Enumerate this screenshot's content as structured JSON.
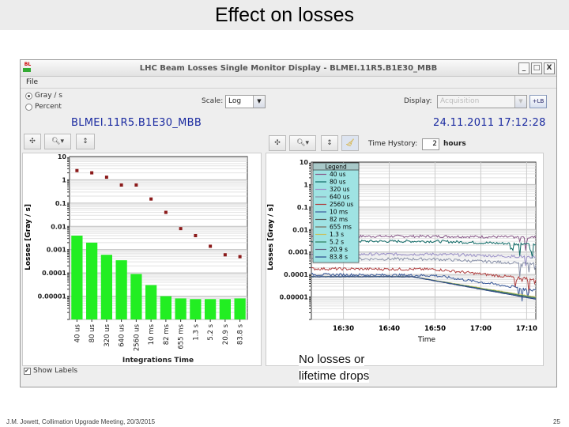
{
  "slide": {
    "title": "Effect on losses",
    "footer": "J.M. Jowett, Collimation Upgrade Meeting, 20/3/2015",
    "page": "25",
    "note_line1": "No losses or",
    "note_line2": "lifetime drops"
  },
  "window": {
    "title": "LHC Beam Losses Single Monitor Display - BLMEI.11R5.B1E30_MBB",
    "icon_text": "BL",
    "minimize": "_",
    "maximize": "□",
    "close": "X"
  },
  "menu": {
    "file": "File"
  },
  "controls": {
    "unit_gray": "Gray / s",
    "unit_percent": "Percent",
    "unit_selected": "Gray / s",
    "scale_label": "Scale:",
    "scale_value": "Log",
    "display_label": "Display:",
    "display_value": "Acquisition",
    "display_button": "+LB",
    "monitor": "BLMEI.11R5.B1E30_MBB",
    "timestamp": "24.11.2011 17:12:28",
    "time_history_label": "Time Hystory:",
    "time_history_value": "2",
    "time_history_unit": "hours",
    "show_labels": "Show Labels",
    "show_labels_checked": true
  },
  "chart_data": [
    {
      "type": "bar",
      "ylabel": "Losses [Gray / s]",
      "xlabel": "Integrations Time",
      "yscale": "log",
      "ylim": [
        1e-06,
        10
      ],
      "yticks": [
        "10",
        "1",
        "0.1",
        "0.01",
        "0.001",
        "0.0001",
        "0.00001"
      ],
      "categories": [
        "40 us",
        "80 us",
        "320 us",
        "640 us",
        "2560 us",
        "10 ms",
        "82 ms",
        "655 ms",
        "1.3 s",
        "5.2 s",
        "20.9 s",
        "83.8 s"
      ],
      "series": [
        {
          "kind": "bar",
          "color": "#22ee22",
          "values": [
            0.004,
            0.002,
            0.0006,
            0.00035,
            9e-05,
            3e-05,
            1e-05,
            8e-06,
            7.5e-06,
            7.5e-06,
            7.5e-06,
            8e-06
          ]
        },
        {
          "kind": "marker",
          "color": "#8b1a1a",
          "values": [
            2.5,
            2,
            1.3,
            0.6,
            0.6,
            0.15,
            0.04,
            0.008,
            0.004,
            0.0014,
            0.0006,
            0.0005
          ]
        }
      ],
      "grid": true
    },
    {
      "type": "line",
      "ylabel": "Losses [Gray / s]",
      "xlabel": "Time",
      "yscale": "log",
      "ylim": [
        1e-06,
        10
      ],
      "yticks": [
        "10",
        "1",
        "0.1",
        "0.01",
        "0.001",
        "0.0001",
        "0.00001"
      ],
      "xticks": [
        "16:30",
        "16:40",
        "16:50",
        "17:00",
        "17:10"
      ],
      "xlim": [
        "16:23",
        "17:12"
      ],
      "legend_title": "Legend",
      "legend_position": "top-left",
      "grid": true,
      "series": [
        {
          "name": "40 us",
          "color": "#8a5a8a",
          "points": [
            [
              "16:23",
              0.005
            ],
            [
              "16:50",
              0.005
            ],
            [
              "17:12",
              0.0045
            ]
          ]
        },
        {
          "name": "80 us",
          "color": "#0f6a66",
          "points": [
            [
              "16:23",
              0.003
            ],
            [
              "16:50",
              0.003
            ],
            [
              "17:12",
              0.0022
            ]
          ]
        },
        {
          "name": "320 us",
          "color": "#9a90c8",
          "points": [
            [
              "16:23",
              0.0008
            ],
            [
              "16:50",
              0.0008
            ],
            [
              "17:12",
              0.0006
            ]
          ]
        },
        {
          "name": "640 us",
          "color": "#8890a8",
          "points": [
            [
              "16:23",
              0.0005
            ],
            [
              "16:50",
              0.00048
            ],
            [
              "17:12",
              0.0003
            ]
          ]
        },
        {
          "name": "2560 us",
          "color": "#b04040",
          "points": [
            [
              "16:23",
              0.00018
            ],
            [
              "16:50",
              0.00017
            ],
            [
              "17:12",
              6e-05
            ]
          ]
        },
        {
          "name": "10 ms",
          "color": "#3a5a9a",
          "points": [
            [
              "16:23",
              0.0001
            ],
            [
              "16:50",
              9e-05
            ],
            [
              "17:12",
              2e-05
            ]
          ]
        },
        {
          "name": "82 ms",
          "color": "#555555",
          "points": [
            [
              "16:23",
              8e-05
            ],
            [
              "16:45",
              8e-05
            ],
            [
              "17:12",
              8e-06
            ]
          ]
        },
        {
          "name": "655 ms",
          "color": "#7a6a5a",
          "points": [
            [
              "16:23",
              8e-05
            ],
            [
              "16:45",
              8e-05
            ],
            [
              "17:12",
              9e-06
            ]
          ]
        },
        {
          "name": "1.3 s",
          "color": "#c8c060",
          "points": [
            [
              "16:23",
              8e-05
            ],
            [
              "16:45",
              8e-05
            ],
            [
              "17:12",
              1e-05
            ]
          ]
        },
        {
          "name": "5.2 s",
          "color": "#2a7a5a",
          "points": [
            [
              "16:23",
              8e-05
            ],
            [
              "16:45",
              8e-05
            ],
            [
              "17:12",
              9e-06
            ]
          ]
        },
        {
          "name": "20.9 s",
          "color": "#6a6a8a",
          "points": [
            [
              "16:23",
              8e-05
            ],
            [
              "16:45",
              8e-05
            ],
            [
              "17:12",
              8e-06
            ]
          ]
        },
        {
          "name": "83.8 s",
          "color": "#2a4a8a",
          "points": [
            [
              "16:23",
              8e-05
            ],
            [
              "16:45",
              8e-05
            ],
            [
              "17:12",
              8e-06
            ]
          ]
        }
      ]
    }
  ]
}
